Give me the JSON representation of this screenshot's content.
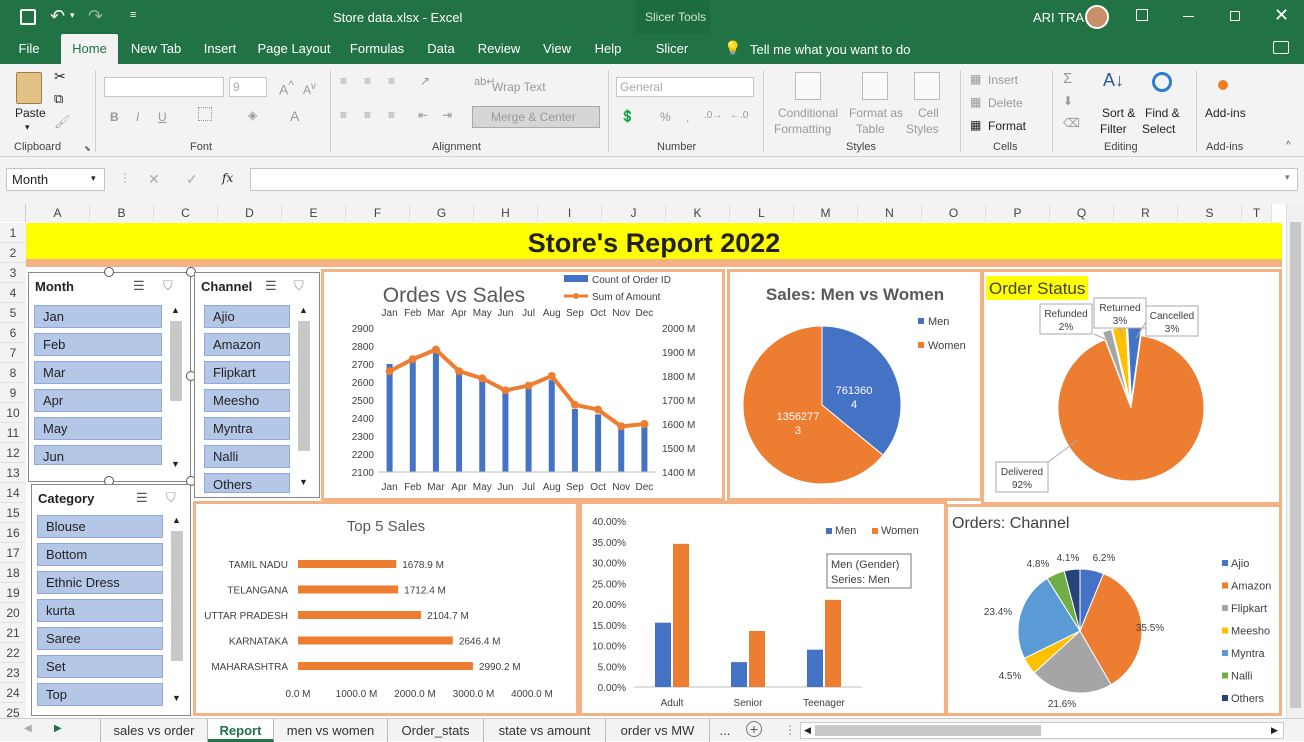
{
  "window": {
    "title": "Store data.xlsx  -  Excel",
    "context_tab_group": "Slicer Tools",
    "user": "ARI TRA"
  },
  "ribbon_tabs": [
    "File",
    "Home",
    "New Tab",
    "Insert",
    "Page Layout",
    "Formulas",
    "Data",
    "Review",
    "View",
    "Help",
    "Slicer"
  ],
  "tell_me": "Tell me what you want to do",
  "ribbon": {
    "clipboard": {
      "paste": "Paste",
      "label": "Clipboard"
    },
    "font": {
      "size": "9",
      "label": "Font"
    },
    "alignment": {
      "wrap": "Wrap Text",
      "merge": "Merge & Center",
      "label": "Alignment"
    },
    "number": {
      "format": "General",
      "label": "Number"
    },
    "styles": {
      "cond1": "Conditional",
      "cond2": "Formatting",
      "fmt1": "Format as",
      "fmt2": "Table",
      "cell1": "Cell",
      "cell2": "Styles",
      "label": "Styles"
    },
    "cells": {
      "insert": "Insert",
      "delete": "Delete",
      "format": "Format",
      "label": "Cells"
    },
    "editing": {
      "sort1": "Sort &",
      "sort2": "Filter",
      "find1": "Find &",
      "find2": "Select",
      "label": "Editing"
    },
    "addins": {
      "btn": "Add-ins",
      "label": "Add-ins"
    }
  },
  "formula_bar": {
    "name_box": "Month",
    "formula": ""
  },
  "columns": [
    "A",
    "B",
    "C",
    "D",
    "E",
    "F",
    "G",
    "H",
    "I",
    "J",
    "K",
    "L",
    "M",
    "N",
    "O",
    "P",
    "Q",
    "R",
    "S",
    "T"
  ],
  "rows": [
    "1",
    "2",
    "3",
    "4",
    "5",
    "6",
    "7",
    "8",
    "9",
    "10",
    "11",
    "12",
    "13",
    "14",
    "15",
    "16",
    "17",
    "18",
    "19",
    "20",
    "21",
    "22",
    "23",
    "24",
    "25"
  ],
  "report_title": "Store's Report 2022",
  "slicers": {
    "month": {
      "title": "Month",
      "items": [
        "Jan",
        "Feb",
        "Mar",
        "Apr",
        "May",
        "Jun"
      ]
    },
    "channel": {
      "title": "Channel",
      "items": [
        "Ajio",
        "Amazon",
        "Flipkart",
        "Meesho",
        "Myntra",
        "Nalli",
        "Others"
      ]
    },
    "category": {
      "title": "Category",
      "items": [
        "Blouse",
        "Bottom",
        "Ethnic Dress",
        "kurta",
        "Saree",
        "Set",
        "Top"
      ]
    }
  },
  "chart_data": [
    {
      "type": "bar",
      "title": "Ordes vs Sales",
      "categories": [
        "Jan",
        "Feb",
        "Mar",
        "Apr",
        "May",
        "Jun",
        "Jul",
        "Aug",
        "Sep",
        "Oct",
        "Nov",
        "Dec"
      ],
      "series": [
        {
          "name": "Count of Order ID",
          "type": "bar",
          "values": [
            2700,
            2720,
            2770,
            2660,
            2610,
            2560,
            2570,
            2610,
            2450,
            2420,
            2370,
            2380
          ]
        },
        {
          "name": "Sum of Amount",
          "type": "line",
          "axis": "right",
          "values": [
            1820,
            1870,
            1910,
            1820,
            1790,
            1740,
            1760,
            1800,
            1680,
            1660,
            1590,
            1600
          ]
        }
      ],
      "yticks_left": [
        "2100",
        "2200",
        "2300",
        "2400",
        "2500",
        "2600",
        "2700",
        "2800",
        "2900"
      ],
      "yticks_right": [
        "1400 M",
        "1500 M",
        "1600 M",
        "1700 M",
        "1800 M",
        "1900 M",
        "2000 M"
      ],
      "ylim_left": [
        2100,
        2900
      ],
      "ylim_right": [
        1400,
        2000
      ],
      "colors": [
        "#4472c4",
        "#ed7d31"
      ]
    },
    {
      "type": "pie",
      "title": "Sales: Men vs Women",
      "labels": [
        "Men",
        "Women"
      ],
      "values": [
        7613604,
        13562773
      ],
      "data_labels": [
        [
          "761360",
          "4"
        ],
        [
          "1356277",
          "3"
        ]
      ],
      "colors": [
        "#4472c4",
        "#ed7d31"
      ]
    },
    {
      "type": "pie",
      "title": "Order Status",
      "labels": [
        "Delivered",
        "Refunded",
        "Returned",
        "Cancelled"
      ],
      "values": [
        92,
        2,
        3,
        3
      ],
      "data_labels": [
        [
          "Delivered",
          "92%"
        ],
        [
          "Refunded",
          "2%"
        ],
        [
          "Returned",
          "3%"
        ],
        [
          "Cancelled",
          "3%"
        ]
      ],
      "colors": [
        "#ed7d31",
        "#a5a5a5",
        "#ffc000",
        "#4472c4"
      ]
    },
    {
      "type": "bar",
      "orientation": "horizontal",
      "title": "Top 5 Sales",
      "categories": [
        "TAMIL NADU",
        "TELANGANA",
        "UTTAR PRADESH",
        "KARNATAKA",
        "MAHARASHTRA"
      ],
      "values": [
        1678.9,
        1712.4,
        2104.7,
        2646.4,
        2990.2
      ],
      "data_labels": [
        "1678.9 M",
        "1712.4 M",
        "2104.7 M",
        "2646.4 M",
        "2990.2 M"
      ],
      "xticks": [
        "0.0 M",
        "1000.0 M",
        "2000.0 M",
        "3000.0 M",
        "4000.0 M"
      ],
      "xlim": [
        0,
        4000
      ],
      "color": "#ed7d31"
    },
    {
      "type": "bar",
      "categories": [
        "Adult",
        "Senior",
        "Teenager"
      ],
      "series": [
        {
          "name": "Men",
          "values": [
            15.5,
            6,
            9
          ]
        },
        {
          "name": "Women",
          "values": [
            34.5,
            13.5,
            21
          ]
        }
      ],
      "yticks": [
        "0.00%",
        "5.00%",
        "10.00%",
        "15.00%",
        "20.00%",
        "25.00%",
        "30.00%",
        "35.00%",
        "40.00%"
      ],
      "ylim": [
        0,
        40
      ],
      "tooltip": [
        "Men (Gender)",
        "Series: Men"
      ],
      "colors": [
        "#4472c4",
        "#ed7d31"
      ]
    },
    {
      "type": "pie",
      "title": "Orders: Channel",
      "labels": [
        "Ajio",
        "Amazon",
        "Flipkart",
        "Meesho",
        "Myntra",
        "Nalli",
        "Others"
      ],
      "values": [
        6.2,
        35.5,
        21.6,
        4.5,
        23.4,
        4.8,
        4.1
      ],
      "data_labels": [
        "6.2%",
        "35.5%",
        "21.6%",
        "4.5%",
        "23.4%",
        "4.8%",
        "4.1%"
      ],
      "colors": [
        "#4472c4",
        "#ed7d31",
        "#a5a5a5",
        "#ffc000",
        "#5b9bd5",
        "#70ad47",
        "#264478"
      ]
    }
  ],
  "sheet_tabs": [
    "sales vs order",
    "Report",
    "men vs women",
    "Order_stats",
    "state vs amount",
    "order vs MW",
    "..."
  ]
}
